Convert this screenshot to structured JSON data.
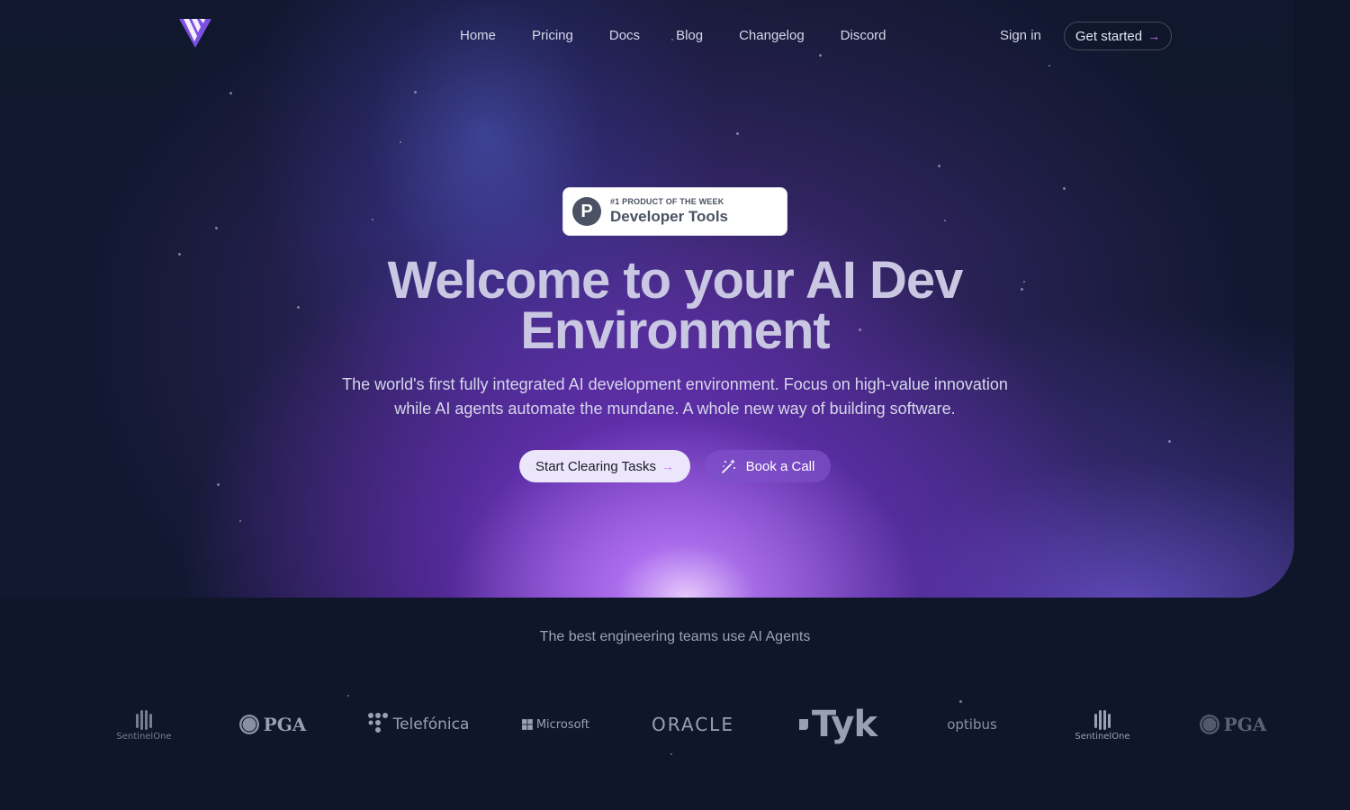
{
  "nav": {
    "links": [
      "Home",
      "Pricing",
      "Docs",
      "Blog",
      "Changelog",
      "Discord"
    ],
    "sign_in": "Sign in",
    "get_started": "Get started",
    "arrow": "→"
  },
  "badge": {
    "small": "#1 PRODUCT OF THE WEEK",
    "big": "Developer Tools",
    "icon_letter": "P"
  },
  "hero": {
    "title_line1": "Welcome to your AI Dev",
    "title_line2": "Environment",
    "subtitle_line1": "The world's first fully integrated AI development environment. Focus on high-value innovation",
    "subtitle_line2": "while AI agents automate the mundane. A whole new way of building software.",
    "cta_primary": "Start Clearing Tasks",
    "cta_secondary": "Book a Call"
  },
  "teams": {
    "text": "The best engineering teams use AI Agents",
    "logos": [
      "SentinelOne",
      "PGA",
      "Telefónica",
      "Microsoft",
      "ORACLE",
      "Tyk",
      "optibus",
      "SentinelOne",
      "PGA"
    ]
  },
  "colors": {
    "background": "#0f1629",
    "accent": "#9b5cf6",
    "arrow": "#c27cff"
  }
}
